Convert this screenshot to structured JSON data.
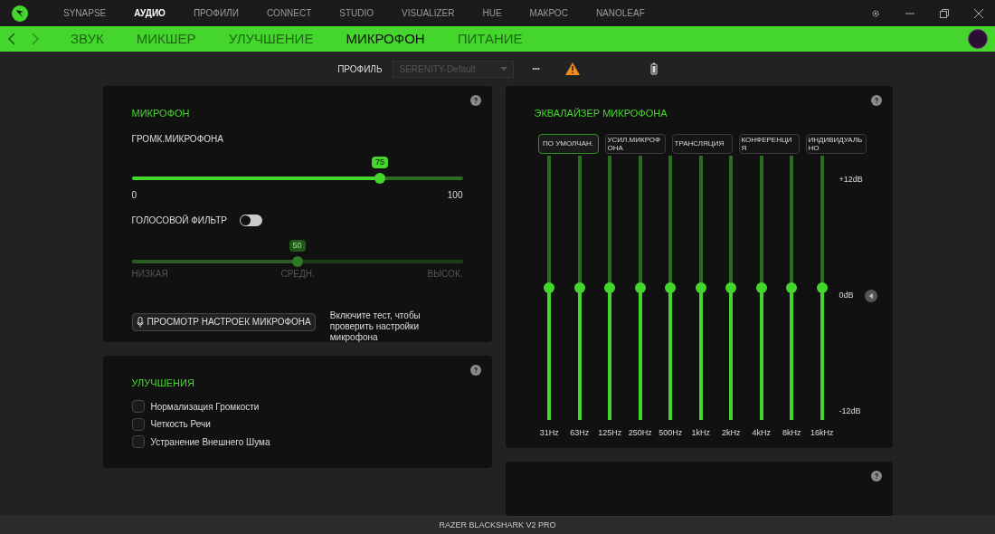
{
  "top_nav": {
    "items": [
      {
        "label": "SYNAPSE",
        "selected": false
      },
      {
        "label": "АУДИО",
        "selected": true
      },
      {
        "label": "ПРОФИЛИ",
        "selected": false
      },
      {
        "label": "CONNECT",
        "selected": false
      },
      {
        "label": "STUDIO",
        "selected": false
      },
      {
        "label": "VISUALIZER",
        "selected": false
      },
      {
        "label": "HUE",
        "selected": false
      },
      {
        "label": "МАКРОС",
        "selected": false
      },
      {
        "label": "NANOLEAF",
        "selected": false
      }
    ]
  },
  "sub_nav": {
    "items": [
      {
        "label": "ЗВУК",
        "selected": false
      },
      {
        "label": "МИКШЕР",
        "selected": false
      },
      {
        "label": "УЛУЧШЕНИЕ",
        "selected": false
      },
      {
        "label": "МИКРОФОН",
        "selected": true
      },
      {
        "label": "ПИТАНИЕ",
        "selected": false
      }
    ]
  },
  "profile": {
    "label": "ПРОФИЛЬ",
    "value": "SERENITY-Default",
    "more": "•••"
  },
  "mic_panel": {
    "title": "МИКРОФОН",
    "volume": {
      "label": "ГРОМК.МИКРОФОНА",
      "value": "75",
      "level": 0.75,
      "min": "0",
      "max": "100"
    },
    "voice_filter": {
      "label": "ГОЛОСОВОЙ ФИЛЬТР",
      "on": false,
      "value": "50",
      "level": 0.5,
      "marks": [
        "НИЗКАЯ",
        "СРЕДН.",
        "ВЫСОК."
      ]
    },
    "test_button": "ПРОСМОТР НАСТРОЕК МИКРОФОНА",
    "test_hint": "Включите тест, чтобы проверить настройки микрофона"
  },
  "enhancements": {
    "title": "УЛУЧШЕНИЯ",
    "options": [
      {
        "label": "Нормализация Громкости",
        "checked": false
      },
      {
        "label": "Четкость Речи",
        "checked": false
      },
      {
        "label": "Устранение Внешнего Шума",
        "checked": false
      }
    ]
  },
  "equalizer": {
    "title": "ЭКВАЛАЙЗЕР МИКРОФОНА",
    "presets": [
      {
        "label": "ПО УМОЛЧАН.",
        "selected": true
      },
      {
        "label": "УСИЛ.МИКРОФОНА",
        "selected": false
      },
      {
        "label": "ТРАНСЛЯЦИЯ",
        "selected": false
      },
      {
        "label": "КОНФЕРЕНЦИЯ",
        "selected": false
      },
      {
        "label": "ИНДИВИДУАЛЬНО",
        "selected": false
      }
    ],
    "scale": [
      "+12dB",
      "0dB",
      "-12dB"
    ],
    "bands": [
      {
        "label": "31Hz",
        "level": 0.5
      },
      {
        "label": "63Hz",
        "level": 0.5
      },
      {
        "label": "125Hz",
        "level": 0.5
      },
      {
        "label": "250Hz",
        "level": 0.5
      },
      {
        "label": "500Hz",
        "level": 0.5
      },
      {
        "label": "1kHz",
        "level": 0.5
      },
      {
        "label": "2kHz",
        "level": 0.5
      },
      {
        "label": "4kHz",
        "level": 0.5
      },
      {
        "label": "8kHz",
        "level": 0.5
      },
      {
        "label": "16kHz",
        "level": 0.5
      }
    ]
  },
  "status_bar": "RAZER BLACKSHARK V2 PRO"
}
